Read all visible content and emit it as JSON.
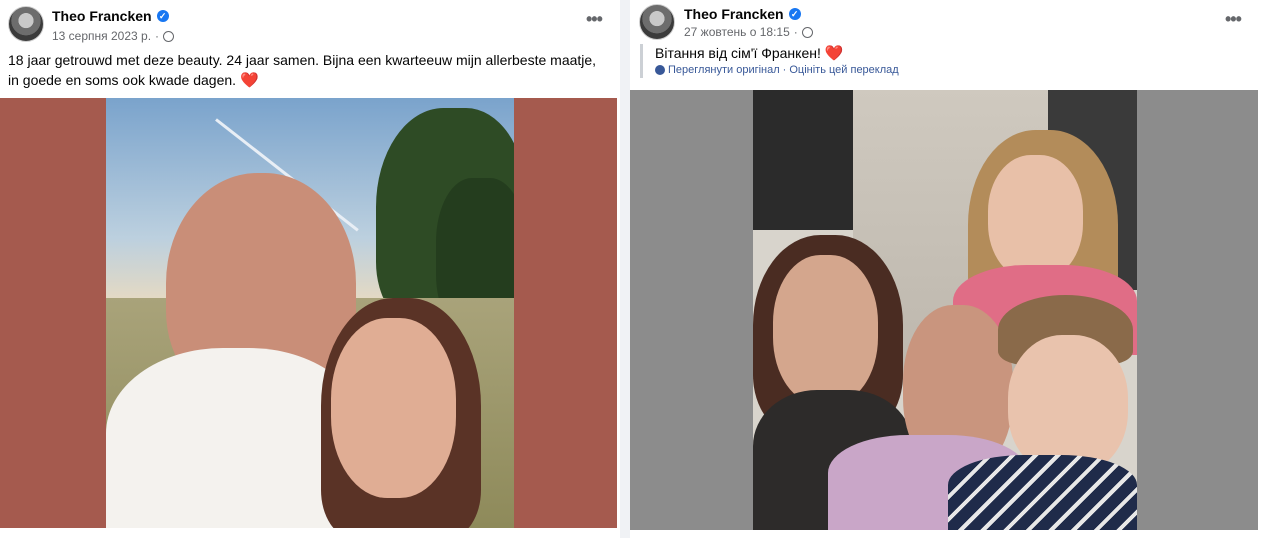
{
  "post1": {
    "author": "Theo Francken",
    "date": "13 серпня 2023 р.",
    "separator": "·",
    "more": "•••",
    "caption": "18 jaar getrouwd met deze beauty. 24 jaar samen. Bijna een kwarteeuw mijn allerbeste maatje, in goede en soms ook kwade dagen.",
    "heart": "❤️",
    "verified": "✓"
  },
  "post2": {
    "author": "Theo Francken",
    "date": "27 жовтень о 18:15",
    "separator": "·",
    "more": "•••",
    "caption": "Вітання від сім'ї Франкен!",
    "heart": "❤️",
    "links": {
      "see_original": "Переглянути оригінал",
      "dot": "·",
      "rate": "Оцініть цей переклад"
    },
    "verified": "✓"
  },
  "colors": {
    "frame1": "#a55a4e",
    "frame2": "#8c8c8c",
    "link": "#385898",
    "verified": "#1877f2"
  },
  "icons": {
    "verified": "verified-badge-icon",
    "audience": "globe-icon",
    "more": "more-options-icon",
    "settings": "gear-icon"
  }
}
